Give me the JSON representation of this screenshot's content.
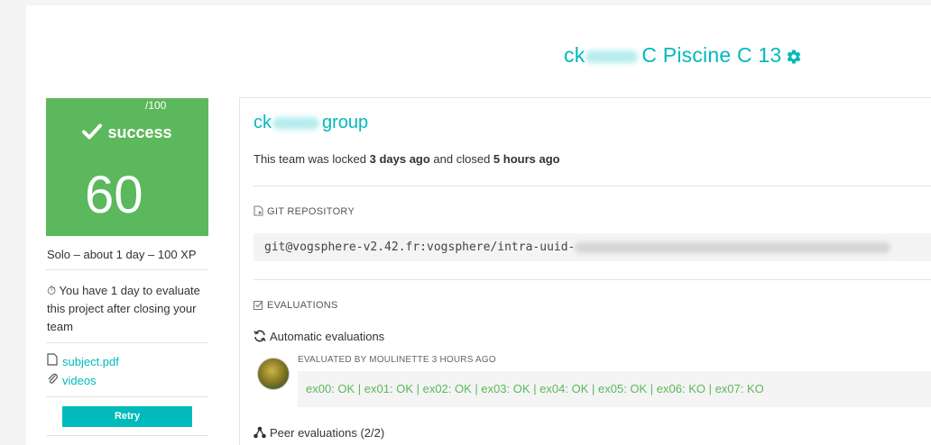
{
  "header": {
    "title_prefix": "ck",
    "title_suffix": "C Piscine C 13",
    "settings_icon": "gear-icon"
  },
  "score": {
    "status": "success",
    "value": "60",
    "max": "/100",
    "color": "#5cb85c"
  },
  "project_info": {
    "meta": "Solo – about 1 day – 100 XP",
    "evaluation_notice": "You have 1 day to evaluate this project after closing your team"
  },
  "links": [
    {
      "label": "subject.pdf",
      "icon": "file-icon"
    },
    {
      "label": "videos",
      "icon": "paperclip-icon"
    }
  ],
  "retry_label": "Retry",
  "team": {
    "name_prefix": "ck",
    "name_suffix": "group",
    "lock_text_1": "This team was locked ",
    "lock_time": "3 days ago",
    "lock_text_2": " and closed ",
    "close_time": "5 hours ago"
  },
  "git": {
    "label": "GIT REPOSITORY",
    "url": "git@vogsphere-v2.42.fr:vogsphere/intra-uuid-"
  },
  "evaluations": {
    "label": "EVALUATIONS",
    "automatic_label": "Automatic evaluations",
    "evaluated_by": "EVALUATED BY MOULINETTE 3 HOURS AGO",
    "result": "ex00: OK | ex01: OK | ex02: OK | ex03: OK | ex04: OK | ex05: OK | ex06: KO | ex07: KO",
    "peer_label": "Peer evaluations (2/2)"
  },
  "colors": {
    "accent": "#00babc",
    "success": "#5cb85c"
  }
}
